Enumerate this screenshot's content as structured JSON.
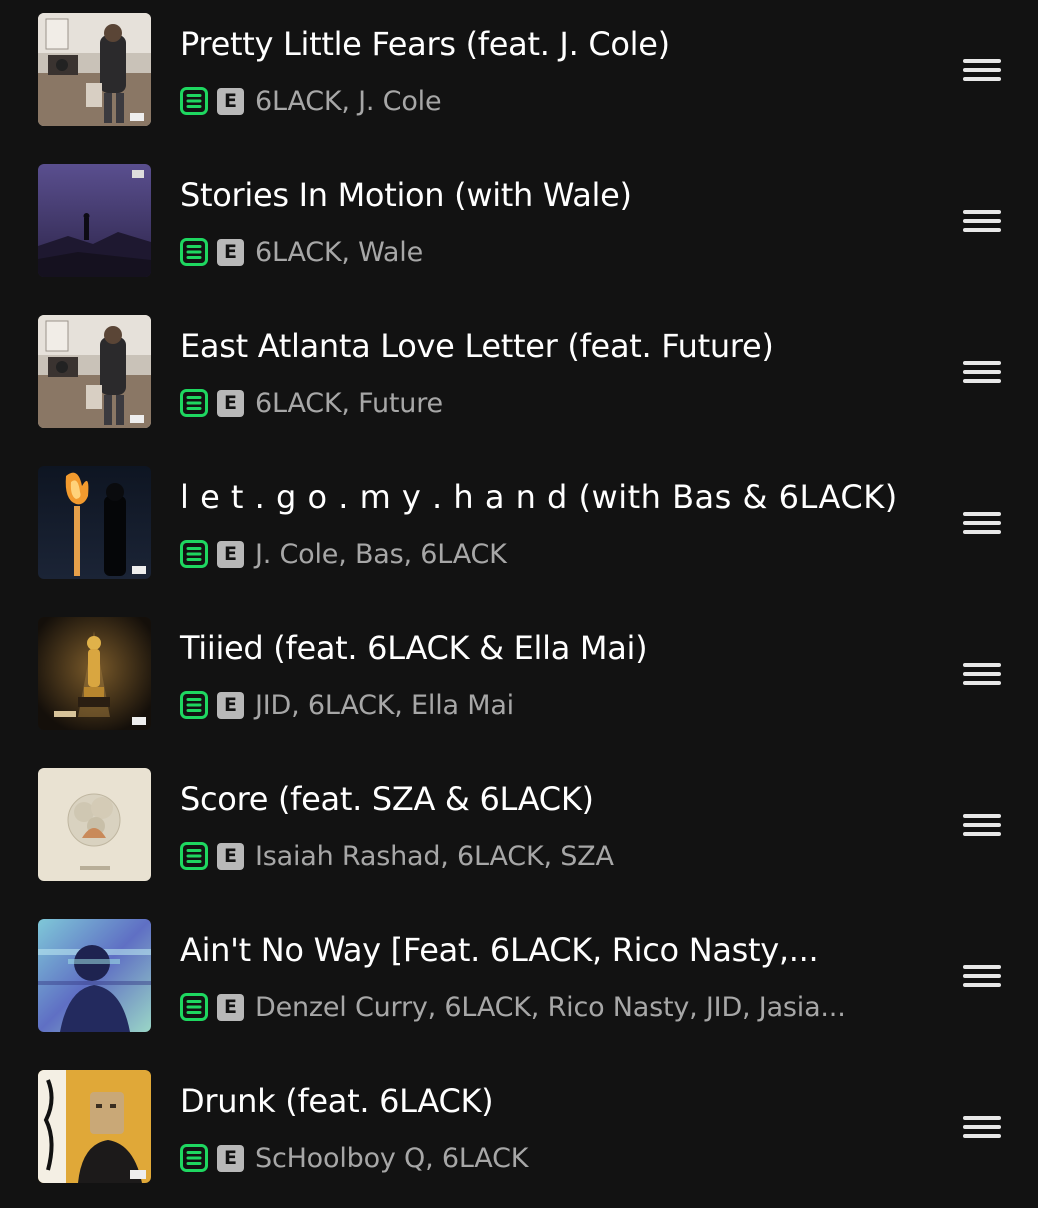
{
  "colors": {
    "background": "#121212",
    "title": "#ffffff",
    "subtitle": "#a7a7a7",
    "downloaded_accent": "#1ed760",
    "explicit_badge": "#b8b8b8"
  },
  "tracks": [
    {
      "title": "Pretty Little Fears (feat. J. Cole)",
      "artists": "6LACK, J. Cole",
      "explicit_label": "E",
      "downloaded_icon": "downloaded-icon",
      "handle_icon": "drag-handle-icon"
    },
    {
      "title": "Stories In Motion (with Wale)",
      "artists": "6LACK, Wale",
      "explicit_label": "E",
      "downloaded_icon": "downloaded-icon",
      "handle_icon": "drag-handle-icon"
    },
    {
      "title": "East Atlanta Love Letter (feat. Future)",
      "artists": "6LACK, Future",
      "explicit_label": "E",
      "downloaded_icon": "downloaded-icon",
      "handle_icon": "drag-handle-icon"
    },
    {
      "title": "l e t . g o . m y . h a n d (with Bas & 6LACK)",
      "artists": "J. Cole, Bas, 6LACK",
      "explicit_label": "E",
      "downloaded_icon": "downloaded-icon",
      "handle_icon": "drag-handle-icon"
    },
    {
      "title": "Tiiied (feat. 6LACK & Ella Mai)",
      "artists": "JID, 6LACK, Ella Mai",
      "explicit_label": "E",
      "downloaded_icon": "downloaded-icon",
      "handle_icon": "drag-handle-icon"
    },
    {
      "title": "Score (feat. SZA & 6LACK)",
      "artists": "Isaiah Rashad, 6LACK, SZA",
      "explicit_label": "E",
      "downloaded_icon": "downloaded-icon",
      "handle_icon": "drag-handle-icon"
    },
    {
      "title": "Ain't No Way [Feat. 6LACK, Rico Nasty,...",
      "artists": "Denzel Curry, 6LACK, Rico Nasty, JID, Jasia...",
      "explicit_label": "E",
      "downloaded_icon": "downloaded-icon",
      "handle_icon": "drag-handle-icon"
    },
    {
      "title": "Drunk (feat. 6LACK)",
      "artists": "ScHoolboy Q, 6LACK",
      "explicit_label": "E",
      "downloaded_icon": "downloaded-icon",
      "handle_icon": "drag-handle-icon"
    }
  ]
}
